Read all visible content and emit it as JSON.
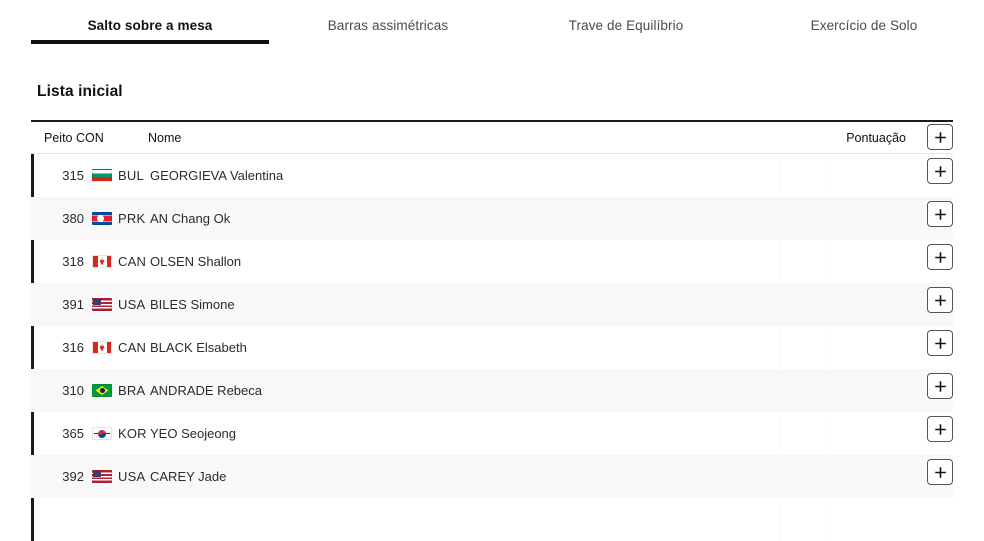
{
  "tabs": [
    {
      "label": "Salto sobre a mesa",
      "active": true
    },
    {
      "label": "Barras assimétricas",
      "active": false
    },
    {
      "label": "Trave de Equilíbrio",
      "active": false
    },
    {
      "label": "Exercício de Solo",
      "active": false
    }
  ],
  "section": {
    "title": "Lista inicial"
  },
  "table": {
    "headers": {
      "bib_noc": "Peito CON",
      "name": "Nome",
      "score": "Pontuação"
    },
    "add_button_label": "+",
    "rows": [
      {
        "bib": "315",
        "noc": "BUL",
        "name": "GEORGIEVA Valentina",
        "score": ""
      },
      {
        "bib": "380",
        "noc": "PRK",
        "name": "AN Chang Ok",
        "score": ""
      },
      {
        "bib": "318",
        "noc": "CAN",
        "name": "OLSEN Shallon",
        "score": ""
      },
      {
        "bib": "391",
        "noc": "USA",
        "name": "BILES Simone",
        "score": ""
      },
      {
        "bib": "316",
        "noc": "CAN",
        "name": "BLACK Elsabeth",
        "score": ""
      },
      {
        "bib": "310",
        "noc": "BRA",
        "name": "ANDRADE Rebeca",
        "score": ""
      },
      {
        "bib": "365",
        "noc": "KOR",
        "name": "YEO Seojeong",
        "score": ""
      },
      {
        "bib": "392",
        "noc": "USA",
        "name": "CAREY Jade",
        "score": ""
      },
      {
        "bib": "",
        "noc": "",
        "name": "",
        "score": ""
      }
    ]
  },
  "colors": {
    "accent": "#111111",
    "text": "#2a2a33",
    "muted": "#4a4a52",
    "row_alt": "#f8f8f8",
    "border": "#e8e8e8"
  },
  "icons": {
    "add": "plus-icon"
  }
}
